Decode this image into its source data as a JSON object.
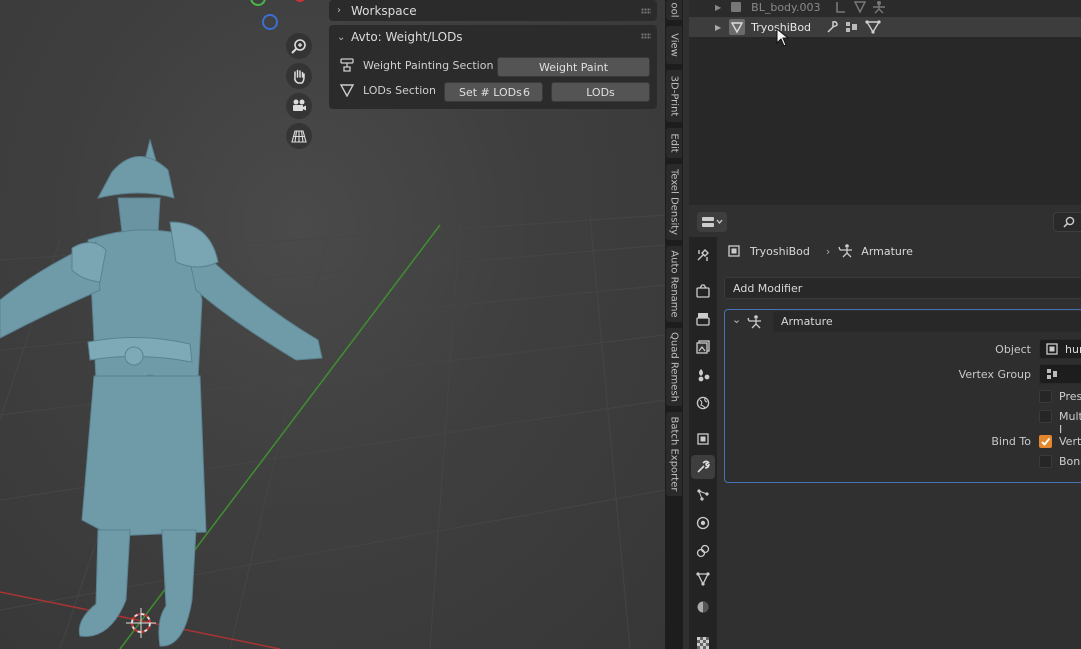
{
  "npanel": {
    "workspace_label": "Workspace",
    "avto_label": "Avto: Weight/LODs",
    "weight_section_label": "Weight Painting Section",
    "weight_paint_button": "Weight Paint",
    "lods_section_label": "LODs Section",
    "set_lods_label": "Set # LODs",
    "set_lods_value": "6",
    "lods_button": "LODs"
  },
  "side_tabs": [
    "ool",
    "View",
    "3D-Print",
    "Edit",
    "Texel Density",
    "Auto Rename",
    "Quad Remesh",
    "Batch Exporter"
  ],
  "outliner": {
    "items": [
      {
        "name": "BL_body.003"
      },
      {
        "name": "TryoshiBod"
      }
    ]
  },
  "properties": {
    "breadcrumb_object": "TryoshiBod",
    "breadcrumb_modifier": "Armature",
    "add_modifier_label": "Add Modifier",
    "modifier_name": "Armature",
    "object_label": "Object",
    "object_value": "hun",
    "vertex_group_label": "Vertex Group",
    "preserve_label": "Prese",
    "multi_label": "Multi I",
    "bind_to_label": "Bind To",
    "vertex_label": "Verte",
    "bone_label": "Bone",
    "preserve_checked": false,
    "multi_checked": false,
    "vertex_checked": true,
    "bone_checked": false
  },
  "colors": {
    "accent_orange": "#e3872c",
    "selection_blue": "#4772b3"
  }
}
